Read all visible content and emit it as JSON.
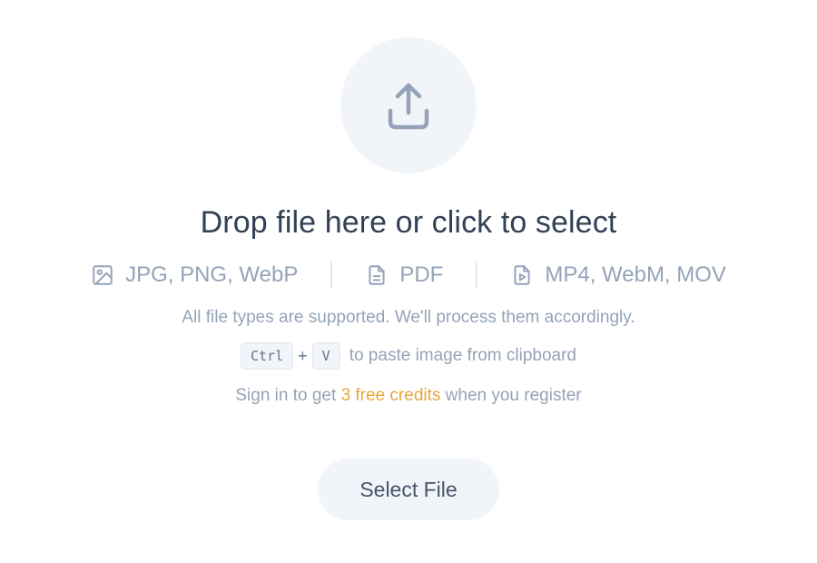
{
  "upload": {
    "icon": "upload-icon",
    "headline": "Drop file here or click to select"
  },
  "formats": [
    {
      "icon": "image-icon",
      "label": "JPG, PNG, WebP"
    },
    {
      "icon": "document-icon",
      "label": "PDF"
    },
    {
      "icon": "video-file-icon",
      "label": "MP4, WebM, MOV"
    }
  ],
  "support_note": "All file types are supported. We'll process them accordingly.",
  "paste_hint": {
    "key1": "Ctrl",
    "plus": "+",
    "key2": "V",
    "text": "to paste image from clipboard"
  },
  "signin_note": {
    "prefix": "Sign in to get ",
    "highlight": "3 free credits",
    "suffix": " when you register"
  },
  "button": {
    "label": "Select File"
  },
  "colors": {
    "accent": "#e8a63a",
    "muted_text": "#94a3b8",
    "heading_text": "#334155",
    "surface": "#f1f5f9"
  }
}
